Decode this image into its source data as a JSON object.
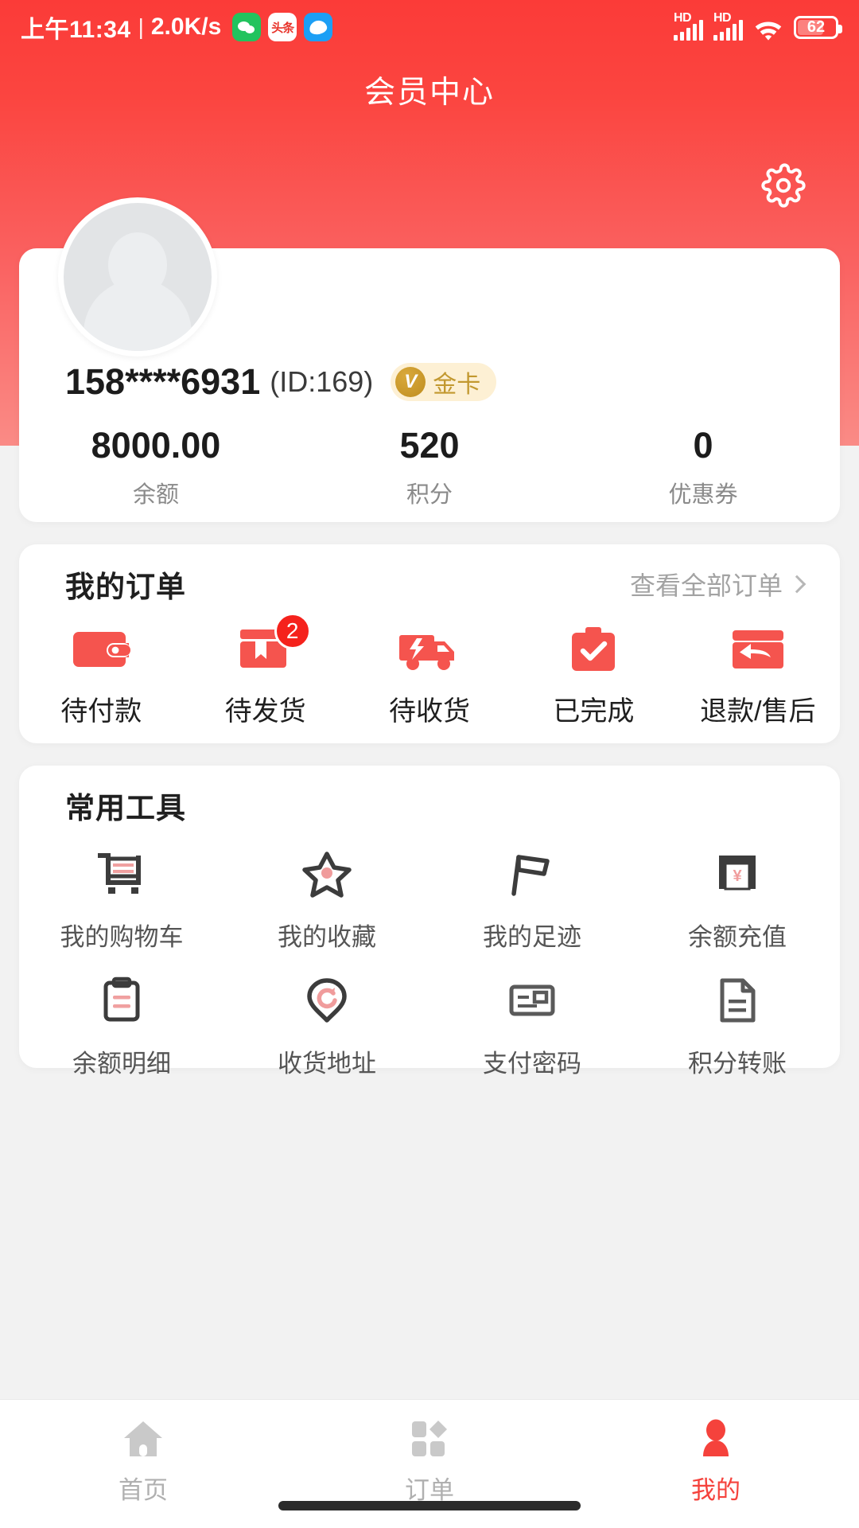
{
  "status_bar": {
    "time": "上午11:34",
    "separator": "|",
    "network_speed": "2.0K/s",
    "apps": [
      {
        "name": "wechat-app-icon",
        "label": ""
      },
      {
        "name": "toutiao-app-icon",
        "label": "头条"
      },
      {
        "name": "blue-app-icon",
        "label": ""
      }
    ],
    "signal_label": "HD",
    "battery_level": "62"
  },
  "header": {
    "title": "会员中心",
    "settings_icon": "gear-icon",
    "gradient_top": "#fb3b38",
    "gradient_bottom": "#fa8b86"
  },
  "profile": {
    "avatar_icon": "user-avatar-placeholder",
    "phone": "158****6931",
    "user_id": "(ID:169)",
    "vip_badge": {
      "mark": "V",
      "label": "金卡",
      "color": "#c2982f",
      "bg": "#fdf0d4"
    },
    "stats": [
      {
        "value": "8000.00",
        "label": "余额"
      },
      {
        "value": "520",
        "label": "积分"
      },
      {
        "value": "0",
        "label": "优惠券"
      }
    ]
  },
  "orders": {
    "title": "我的订单",
    "more_label": "查看全部订单",
    "items": [
      {
        "label": "待付款",
        "icon": "wallet-icon",
        "badge": ""
      },
      {
        "label": "待发货",
        "icon": "package-box-icon",
        "badge": "2"
      },
      {
        "label": "待收货",
        "icon": "delivery-truck-icon",
        "badge": ""
      },
      {
        "label": "已完成",
        "icon": "clipboard-check-icon",
        "badge": ""
      },
      {
        "label": "退款/售后",
        "icon": "refund-card-icon",
        "badge": ""
      }
    ],
    "accent_color": "#f5544e"
  },
  "tools": {
    "title": "常用工具",
    "items": [
      {
        "label": "我的购物车",
        "icon": "shopping-cart-icon"
      },
      {
        "label": "我的收藏",
        "icon": "star-icon"
      },
      {
        "label": "我的足迹",
        "icon": "flag-icon"
      },
      {
        "label": "余额充值",
        "icon": "atm-cash-icon"
      },
      {
        "label": "余额明细",
        "icon": "clipboard-list-icon"
      },
      {
        "label": "收货地址",
        "icon": "location-pin-icon"
      },
      {
        "label": "支付密码",
        "icon": "id-card-icon"
      },
      {
        "label": "积分转账",
        "icon": "document-icon"
      }
    ]
  },
  "tabbar": {
    "items": [
      {
        "label": "首页",
        "icon": "home-icon",
        "active": false
      },
      {
        "label": "订单",
        "icon": "grid-orders-icon",
        "active": false
      },
      {
        "label": "我的",
        "icon": "person-icon",
        "active": true
      }
    ],
    "active_color": "#f5423c",
    "inactive_color": "#b0b0b0"
  }
}
